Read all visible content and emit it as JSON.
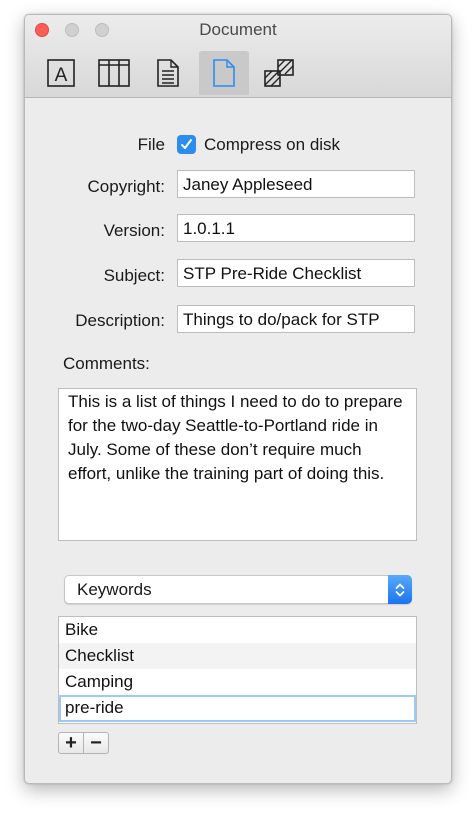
{
  "window": {
    "title": "Document"
  },
  "toolbar": {
    "tools": [
      {
        "icon": "text-style-icon"
      },
      {
        "icon": "table-icon"
      },
      {
        "icon": "document-text-icon"
      },
      {
        "icon": "document-page-icon",
        "active": true
      },
      {
        "icon": "pattern-icon"
      }
    ]
  },
  "form": {
    "file_label": "File",
    "compress_label": "Compress on disk",
    "compress_checked": true,
    "copyright_label": "Copyright:",
    "copyright_value": "Janey Appleseed",
    "version_label": "Version:",
    "version_value": "1.0.1.1",
    "subject_label": "Subject:",
    "subject_value": "STP Pre-Ride Checklist",
    "description_label": "Description:",
    "description_value": "Things to do/pack for STP",
    "comments_label": "Comments:",
    "comments_value": "This is a list of things I need to do to prepare for the two-day Seattle-to-Portland ride in July. Some of these don’t require much effort, unlike the training part of doing this."
  },
  "keywords": {
    "popup_label": "Keywords",
    "items": [
      "Bike",
      "Checklist",
      "Camping",
      "pre-ride"
    ],
    "add_label": "+",
    "remove_label": "−"
  },
  "colors": {
    "accent": "#2d8cf0",
    "close": "#fc5d57"
  }
}
